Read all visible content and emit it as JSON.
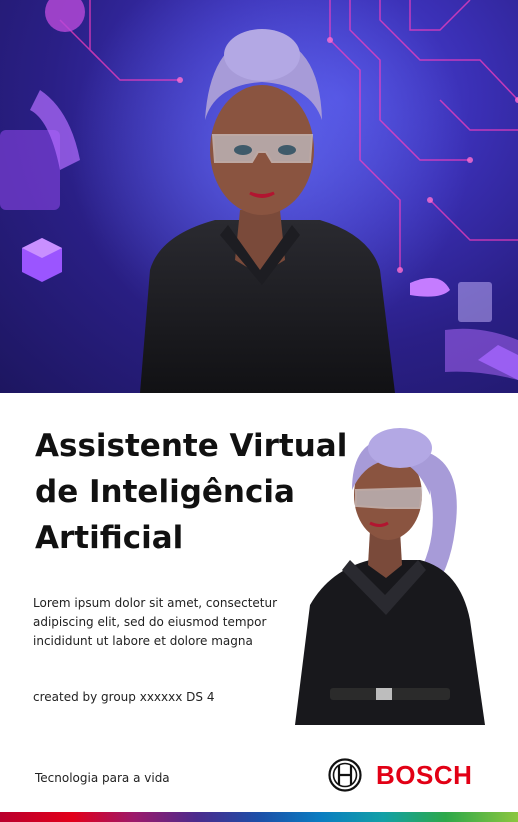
{
  "hero": {
    "image_alt": "virtual-assistant-avatar-hero"
  },
  "title": "Assistente Virtual de Inteligência Artificial",
  "body": "Lorem ipsum dolor sit amet, consectetur adipiscing elit, sed do eiusmod tempor incididunt ut labore et dolore magna",
  "credit": "created by group xxxxxx DS 4",
  "footer": {
    "tagline": "Tecnologia para a vida",
    "brand": "BOSCH"
  },
  "colors": {
    "brand_red": "#e20015",
    "hero_bg": "#3a2fb4",
    "text": "#111111"
  }
}
